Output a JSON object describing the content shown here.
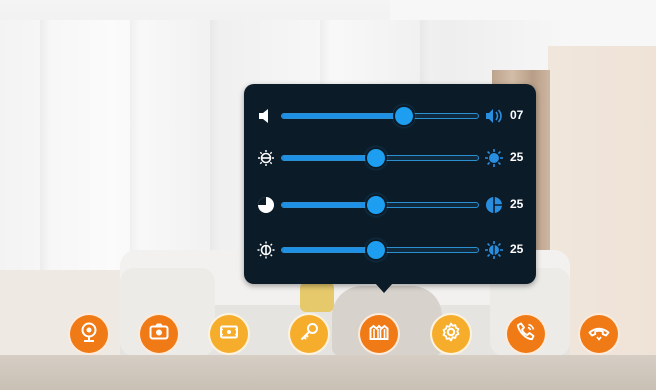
{
  "settings_panel": {
    "rows": [
      {
        "name": "volume",
        "min_icon": "speaker-low-icon",
        "max_icon": "speaker-high-icon",
        "level": 0.62,
        "value": "07"
      },
      {
        "name": "brightness",
        "min_icon": "sun-dim-icon",
        "max_icon": "sun-bright-icon",
        "level": 0.48,
        "value": "25"
      },
      {
        "name": "contrast",
        "min_icon": "contrast-low-icon",
        "max_icon": "contrast-high-icon",
        "level": 0.48,
        "value": "25"
      },
      {
        "name": "saturation",
        "min_icon": "color-dim-icon",
        "max_icon": "color-bright-icon",
        "level": 0.48,
        "value": "25"
      }
    ],
    "accent_color": "#1e90e6",
    "background_color": "#0b1b28"
  },
  "toolbar": {
    "buttons": [
      {
        "icon": "camera-monitor-icon",
        "style": "dark"
      },
      {
        "icon": "snapshot-camera-icon",
        "style": "dark"
      },
      {
        "icon": "record-video-icon",
        "style": "light"
      },
      {
        "icon": "unlock-key-icon",
        "style": "light"
      },
      {
        "icon": "gate-icon",
        "style": "dark"
      },
      {
        "icon": "settings-gear-icon",
        "style": "light"
      },
      {
        "icon": "call-phone-icon",
        "style": "dark"
      },
      {
        "icon": "hang-up-icon",
        "style": "dark"
      }
    ],
    "colors": {
      "dark": "#f07a16",
      "light": "#f6ad2c"
    }
  }
}
